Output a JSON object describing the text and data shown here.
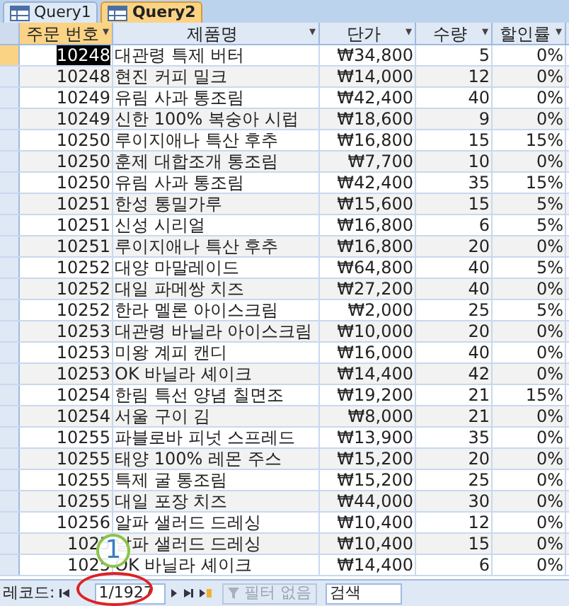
{
  "tabs": [
    {
      "label": "Query1",
      "selected": false
    },
    {
      "label": "Query2",
      "selected": true
    }
  ],
  "columns": [
    {
      "label": "주문 번호",
      "selected": true,
      "sort": "▾"
    },
    {
      "label": "제품명",
      "selected": false,
      "sort": "▾"
    },
    {
      "label": "단가",
      "selected": false,
      "sort": "▾"
    },
    {
      "label": "수량",
      "selected": false,
      "sort": "▾"
    },
    {
      "label": "할인률",
      "selected": false,
      "sort": "▾"
    }
  ],
  "rows": [
    {
      "selected": true,
      "cells": [
        "10248",
        "대관령 특제 버터",
        "₩34,800",
        "5",
        "0%"
      ]
    },
    {
      "selected": false,
      "cells": [
        "10248",
        "현진 커피 밀크",
        "₩14,000",
        "12",
        "0%"
      ]
    },
    {
      "selected": false,
      "cells": [
        "10249",
        "유림 사과 통조림",
        "₩42,400",
        "40",
        "0%"
      ]
    },
    {
      "selected": false,
      "cells": [
        "10249",
        "신한 100% 복숭아 시럽",
        "₩18,600",
        "9",
        "0%"
      ]
    },
    {
      "selected": false,
      "cells": [
        "10250",
        "루이지애나 특산 후추",
        "₩16,800",
        "15",
        "15%"
      ]
    },
    {
      "selected": false,
      "cells": [
        "10250",
        "훈제 대합조개 통조림",
        "₩7,700",
        "10",
        "0%"
      ]
    },
    {
      "selected": false,
      "cells": [
        "10250",
        "유림 사과 통조림",
        "₩42,400",
        "35",
        "15%"
      ]
    },
    {
      "selected": false,
      "cells": [
        "10251",
        "한성 통밀가루",
        "₩15,600",
        "15",
        "5%"
      ]
    },
    {
      "selected": false,
      "cells": [
        "10251",
        "신성 시리얼",
        "₩16,800",
        "6",
        "5%"
      ]
    },
    {
      "selected": false,
      "cells": [
        "10251",
        "루이지애나 특산 후추",
        "₩16,800",
        "20",
        "0%"
      ]
    },
    {
      "selected": false,
      "cells": [
        "10252",
        "대양 마말레이드",
        "₩64,800",
        "40",
        "5%"
      ]
    },
    {
      "selected": false,
      "cells": [
        "10252",
        "대일 파메쌍 치즈",
        "₩27,200",
        "40",
        "0%"
      ]
    },
    {
      "selected": false,
      "cells": [
        "10252",
        "한라 멜론 아이스크림",
        "₩2,000",
        "25",
        "5%"
      ]
    },
    {
      "selected": false,
      "cells": [
        "10253",
        "대관령 바닐라 아이스크림",
        "₩10,000",
        "20",
        "0%"
      ]
    },
    {
      "selected": false,
      "cells": [
        "10253",
        "미왕 계피 캔디",
        "₩16,000",
        "40",
        "0%"
      ]
    },
    {
      "selected": false,
      "cells": [
        "10253",
        "OK 바닐라 셰이크",
        "₩14,400",
        "42",
        "0%"
      ]
    },
    {
      "selected": false,
      "cells": [
        "10254",
        "한림 특선 양념 칠면조",
        "₩19,200",
        "21",
        "15%"
      ]
    },
    {
      "selected": false,
      "cells": [
        "10254",
        "서울 구이 김",
        "₩8,000",
        "21",
        "0%"
      ]
    },
    {
      "selected": false,
      "cells": [
        "10255",
        "파블로바 피넛 스프레드",
        "₩13,900",
        "35",
        "0%"
      ]
    },
    {
      "selected": false,
      "cells": [
        "10255",
        "태양 100% 레몬 주스",
        "₩15,200",
        "20",
        "0%"
      ]
    },
    {
      "selected": false,
      "cells": [
        "10255",
        "특제 굴 통조림",
        "₩15,200",
        "25",
        "0%"
      ]
    },
    {
      "selected": false,
      "cells": [
        "10255",
        "대일 포장 치즈",
        "₩44,000",
        "30",
        "0%"
      ]
    },
    {
      "selected": false,
      "cells": [
        "10256",
        "알파 샐러드 드레싱",
        "₩10,400",
        "12",
        "0%"
      ]
    },
    {
      "selected": false,
      "cells": [
        "1025",
        "알파 샐러드 드레싱",
        "₩10,400",
        "15",
        "0%"
      ]
    },
    {
      "selected": false,
      "cells": [
        "1025",
        "OK 바닐라 셰이크",
        "₩14,400",
        "6",
        "0%"
      ]
    }
  ],
  "navigation": {
    "label": "레코드:",
    "current": "1/1927",
    "filter": "필터 없음",
    "filter_disabled": true,
    "search": "검색"
  },
  "callout": {
    "number": "1"
  }
}
